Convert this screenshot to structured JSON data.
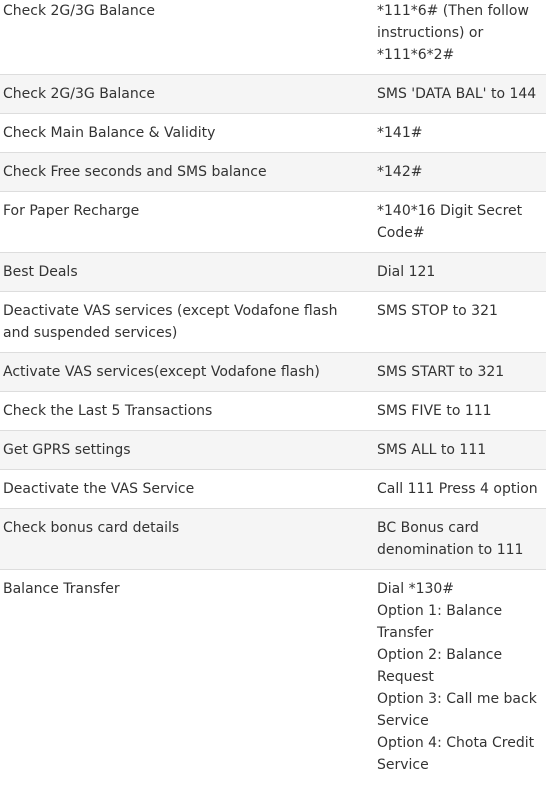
{
  "rows": [
    {
      "feature": "Check 2G/3G Balance",
      "code": [
        "*111*6# (Then follow instructions) or *111*6*2#"
      ]
    },
    {
      "feature": "Check 2G/3G Balance",
      "code": [
        "SMS 'DATA BAL' to 144"
      ]
    },
    {
      "feature": "Check Main Balance & Validity",
      "code": [
        "*141#"
      ]
    },
    {
      "feature": "Check Free seconds and SMS balance",
      "code": [
        "*142#"
      ]
    },
    {
      "feature": "For Paper Recharge",
      "code": [
        "*140*16 Digit Secret Code#"
      ]
    },
    {
      "feature": "Best Deals",
      "code": [
        "Dial 121"
      ]
    },
    {
      "feature": "Deactivate VAS services (except Vodafone flash and suspended services)",
      "code": [
        "SMS STOP to 321"
      ]
    },
    {
      "feature": "Activate VAS services(except Vodafone flash)",
      "code": [
        "SMS START to 321"
      ]
    },
    {
      "feature": "Check the Last 5 Transactions",
      "code": [
        "SMS FIVE to 111"
      ]
    },
    {
      "feature": "Get GPRS settings",
      "code": [
        "SMS ALL to 111"
      ]
    },
    {
      "feature": "Deactivate the VAS Service",
      "code": [
        "Call 111 Press 4 option"
      ]
    },
    {
      "feature": "Check bonus card details",
      "code": [
        "BC Bonus card denomination to 111"
      ]
    },
    {
      "feature": "Balance Transfer",
      "code": [
        "Dial *130#",
        "Option 1: Balance Transfer",
        "Option 2: Balance Request",
        "Option 3: Call me back Service",
        "Option 4: Chota Credit Service"
      ]
    }
  ],
  "colors": {
    "text": "#333333",
    "stripe": "#f5f5f5",
    "border": "#dddddd"
  }
}
